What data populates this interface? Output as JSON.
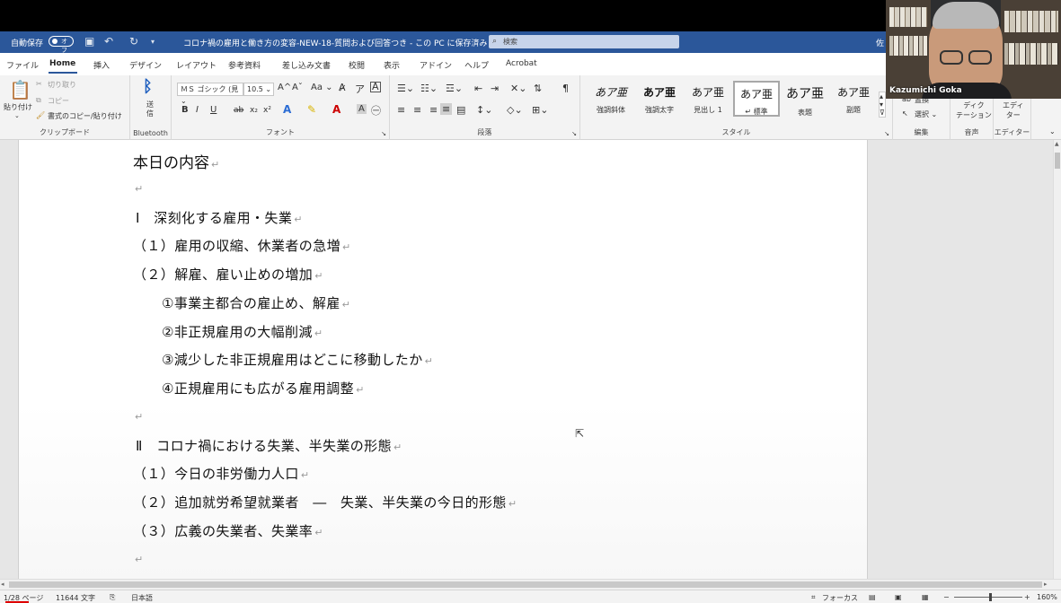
{
  "titlebar": {
    "autosave_label": "自動保存",
    "autosave_state": "オフ",
    "doc_title": "コロナ禍の雇用と働き方の変容-NEW-18-質問および回答つき - この PC に保存済み ⌄",
    "search_placeholder": "検索",
    "user_initial": "佐"
  },
  "menu": {
    "tabs": [
      "ファイル",
      "Home",
      "挿入",
      "デザイン",
      "レイアウト",
      "参考資料",
      "差し込み文書",
      "校閲",
      "表示",
      "アドイン",
      "ヘルプ",
      "Acrobat"
    ]
  },
  "ribbon": {
    "clipboard": {
      "paste": "貼り付け",
      "cut": "切り取り",
      "copy": "コピー",
      "format_painter": "書式のコピー/貼り付け",
      "label": "クリップボード"
    },
    "bluetooth": {
      "send": "送信",
      "label": "Bluetooth"
    },
    "font": {
      "name": "ＭＳ ゴシック (見 ⌄",
      "size": "10.5 ⌄",
      "label": "フォント",
      "grow": "A^",
      "shrink": "Aˇ",
      "case": "Aa ⌄",
      "bold": "B",
      "italic": "I",
      "underline": "U",
      "strike": "ab",
      "sub": "x₂",
      "sup": "x²"
    },
    "paragraph": {
      "label": "段落"
    },
    "styles": {
      "label": "スタイル",
      "items": [
        {
          "preview": "あア亜",
          "name": "強調斜体"
        },
        {
          "preview": "あア亜",
          "name": "強調太字"
        },
        {
          "preview": "あア亜",
          "name": "見出し 1"
        },
        {
          "preview": "あア亜",
          "name": "↵ 標準"
        },
        {
          "preview": "あア亜",
          "name": "表題"
        },
        {
          "preview": "あア亜",
          "name": "副題"
        }
      ]
    },
    "editing": {
      "replace": "置換",
      "select": "選択 ⌄",
      "label": "編集"
    },
    "voice": {
      "dictate": "ディク\nテーション",
      "label": "音声"
    },
    "editor": {
      "editor": "エディ\nター",
      "label": "エディター"
    }
  },
  "document": {
    "lines": [
      "本日の内容",
      "",
      "Ⅰ　深刻化する雇用・失業",
      "（１）雇用の収縮、休業者の急増",
      "（２）解雇、雇い止めの増加",
      "①事業主都合の雇止め、解雇",
      "②非正規雇用の大幅削減",
      "③減少した非正規雇用はどこに移動したか",
      "④正規雇用にも広がる雇用調整",
      "",
      "Ⅱ　コロナ禍における失業、半失業の形態",
      "（１）今日の非労働力人口",
      "（２）追加就労希望就業者　―　失業、半失業の今日的形態",
      "（３）広義の失業者、失業率",
      ""
    ],
    "para_mark": "↵"
  },
  "status": {
    "page": "1/28 ページ",
    "words": "11644 文字",
    "language": "日本語",
    "focus": "フォーカス",
    "zoom": "160%",
    "zoom_minus": "−",
    "zoom_plus": "+"
  },
  "webcam": {
    "name": "Kazumichi Goka"
  }
}
